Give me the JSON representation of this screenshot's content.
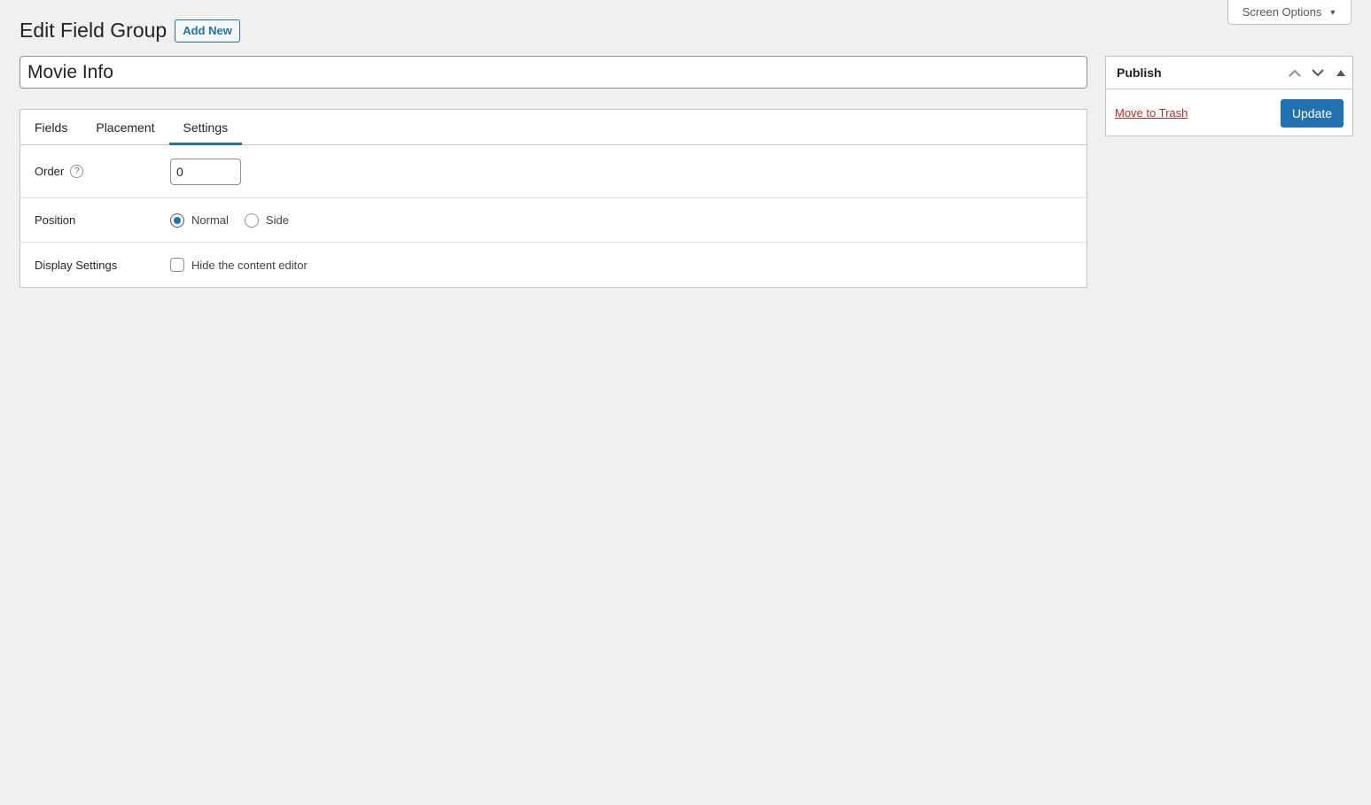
{
  "screen_options": {
    "label": "Screen Options",
    "arrow_icon": "caret-down-icon"
  },
  "header": {
    "title": "Edit Field Group",
    "add_new_label": "Add New"
  },
  "title_field": {
    "value": "Movie Info"
  },
  "tabs": [
    {
      "label": "Fields",
      "active": false
    },
    {
      "label": "Placement",
      "active": false
    },
    {
      "label": "Settings",
      "active": true
    }
  ],
  "settings": {
    "order": {
      "label": "Order",
      "help_icon": "question-icon",
      "help_glyph": "?",
      "value": "0"
    },
    "position": {
      "label": "Position",
      "options": [
        {
          "label": "Normal",
          "checked": true
        },
        {
          "label": "Side",
          "checked": false
        }
      ]
    },
    "display": {
      "label": "Display Settings",
      "checkbox_label": "Hide the content editor",
      "checked": false
    }
  },
  "publish": {
    "title": "Publish",
    "trash_label": "Move to Trash",
    "update_label": "Update"
  },
  "colors": {
    "accent": "#2271b1",
    "danger": "#b32d2e",
    "background": "#f0f0f1"
  }
}
